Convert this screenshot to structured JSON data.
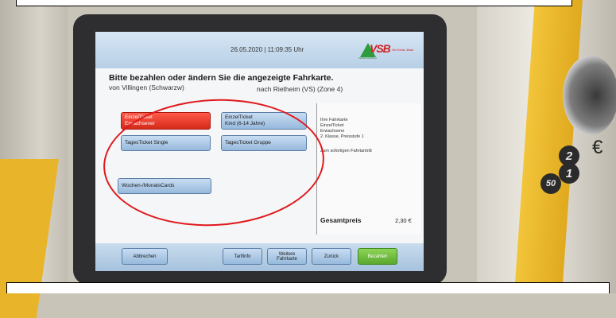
{
  "header": {
    "datetime": "26.05.2020 | 11:09:35 Uhr",
    "logo_text": "VSB",
    "logo_sub": "Ver.Schw.-Baar",
    "logo_tag": "Verkehrsverbund"
  },
  "journey": {
    "heading": "Bitte bezahlen oder ändern Sie die angezeigte Fahrkarte.",
    "from": "von    Villingen (Schwarzw)",
    "to": "nach  Rietheim (VS) (Zone 4)"
  },
  "tickets": [
    {
      "line1": "EinzelTicket",
      "line2": "Erwachsener",
      "selected": true
    },
    {
      "line1": "EinzelTicket",
      "line2": "Kind (6-14 Jahre)",
      "selected": false
    },
    {
      "line1": "TagesTicket Single",
      "line2": "",
      "selected": false
    },
    {
      "line1": "TagesTicket Gruppe",
      "line2": "",
      "selected": false
    },
    {
      "line1": "Wochen-/MonatsCards",
      "line2": "",
      "selected": false
    }
  ],
  "summary": {
    "lines": [
      "Ihre Fahrkarte",
      "EinzelTicket",
      "Erwachsene",
      "2. Klasse, Preisstufe 1"
    ],
    "validity": "Zum sofortigen Fahrtantritt",
    "total_label": "Gesamtpreis",
    "total_value": "2,30 €"
  },
  "footer": {
    "cancel": "Abbrechen",
    "tariff": "Tarifinfo",
    "more_line1": "Weitere",
    "more_line2": "Fahrkarte",
    "back": "Zurück",
    "pay": "Bezahlen"
  },
  "coins": {
    "c1": "2",
    "c2": "1",
    "c3": "50"
  },
  "currency_symbol": "€",
  "colors": {
    "selected": "#e0301e",
    "button": "#b3cde8",
    "pay": "#6cbe38",
    "annotation": "#e0191c"
  }
}
